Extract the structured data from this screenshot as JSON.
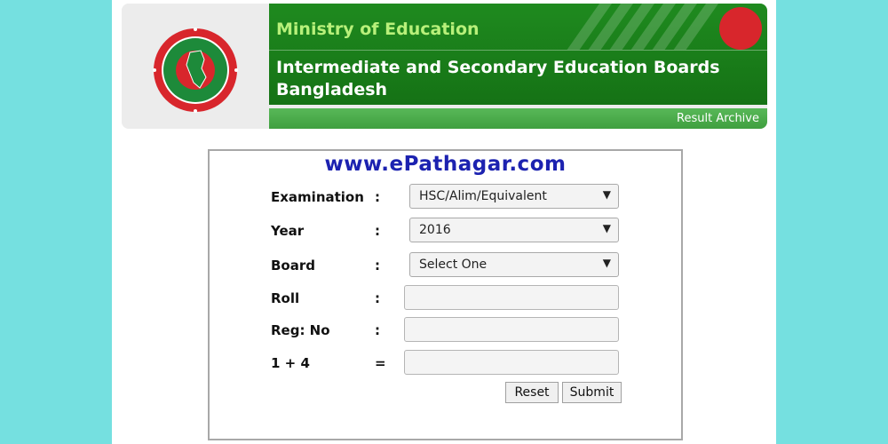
{
  "header": {
    "ministry": "Ministry of Education",
    "boards_line1": "Intermediate and Secondary Education Boards",
    "boards_line2": "Bangladesh",
    "archive_link": "Result Archive"
  },
  "watermark": "www.ePathagar.com",
  "form": {
    "examination": {
      "label": "Examination",
      "sep": ":",
      "value": "HSC/Alim/Equivalent"
    },
    "year": {
      "label": "Year",
      "sep": ":",
      "value": "2016"
    },
    "board": {
      "label": "Board",
      "sep": ":",
      "value": "Select One"
    },
    "roll": {
      "label": "Roll",
      "sep": ":",
      "value": ""
    },
    "reg_no": {
      "label": "Reg: No",
      "sep": ":",
      "value": ""
    },
    "captcha": {
      "label": "1 + 4",
      "sep": "=",
      "value": ""
    },
    "reset_label": "Reset",
    "submit_label": "Submit"
  },
  "colors": {
    "background": "#75e0e0",
    "banner_green": "#1a7a1a",
    "ministry_text": "#b8f07a",
    "watermark": "#1c22b0",
    "seal_red": "#d8262c",
    "seal_green": "#1d8a3a"
  },
  "icons": {
    "dropdown": "chevron-down-icon",
    "logo": "government-seal-icon"
  }
}
